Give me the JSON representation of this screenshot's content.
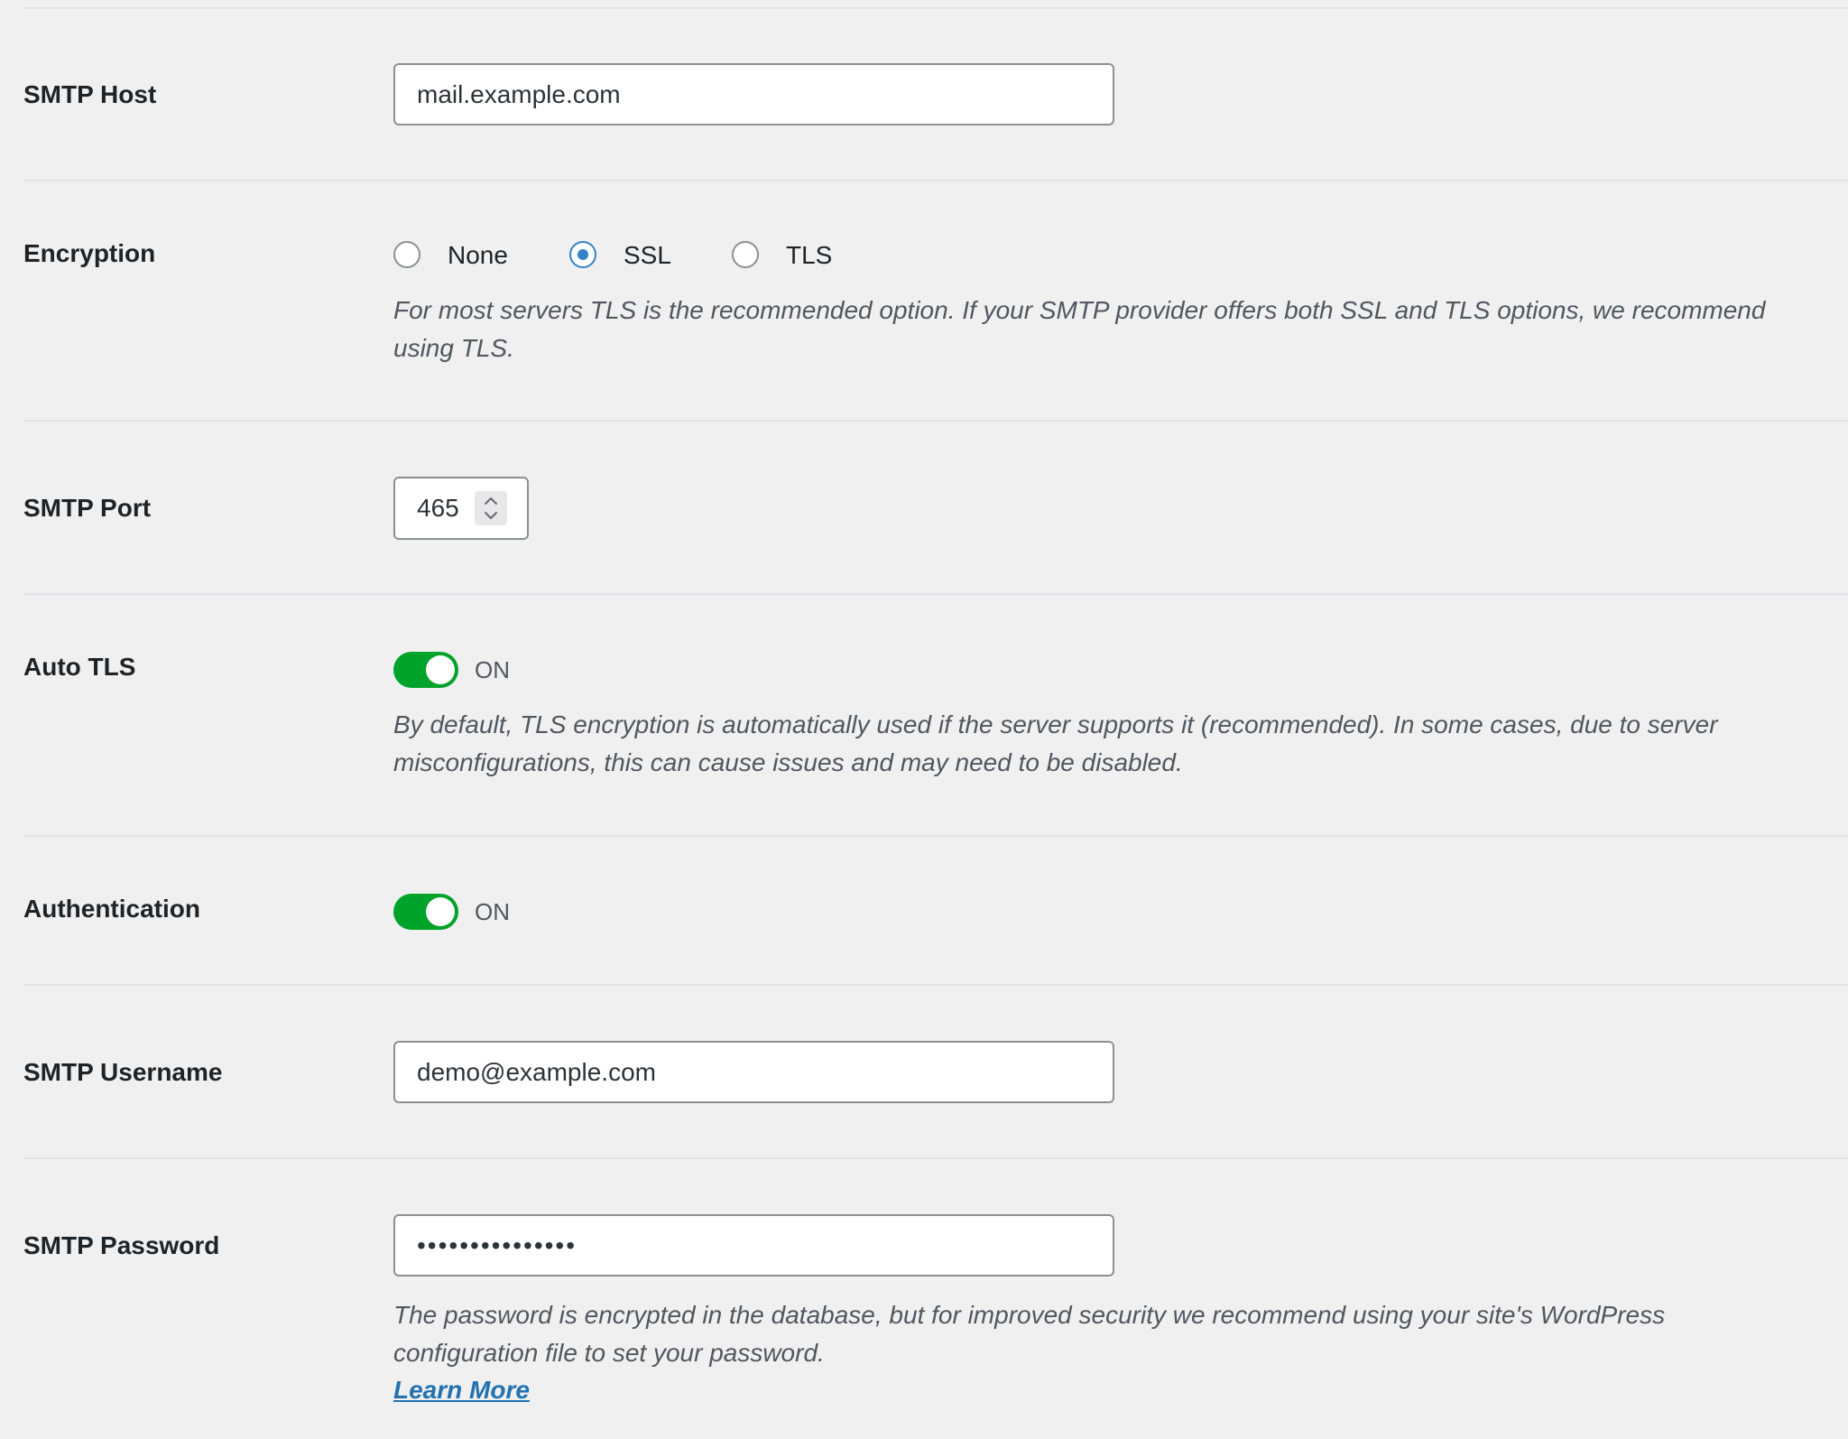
{
  "smtp_host": {
    "label": "SMTP Host",
    "value": "mail.example.com"
  },
  "encryption": {
    "label": "Encryption",
    "options": [
      {
        "label": "None",
        "checked": false
      },
      {
        "label": "SSL",
        "checked": true
      },
      {
        "label": "TLS",
        "checked": false
      }
    ],
    "help_lines": [
      "For most servers TLS is the recommended option. If your SMTP provider offers both SSL and TLS options, we recommend",
      "using TLS."
    ]
  },
  "smtp_port": {
    "label": "SMTP Port",
    "value": "465"
  },
  "auto_tls": {
    "label": "Auto TLS",
    "state": "ON",
    "enabled": true,
    "help_lines": [
      "By default, TLS encryption is automatically used if the server supports it (recommended). In some cases, due to server",
      "misconfigurations, this can cause issues and may need to be disabled."
    ]
  },
  "authentication": {
    "label": "Authentication",
    "state": "ON",
    "enabled": true
  },
  "smtp_username": {
    "label": "SMTP Username",
    "value": "demo@example.com"
  },
  "smtp_password": {
    "label": "SMTP Password",
    "masked_value": "•••••••••••••••",
    "help_lines": [
      "The password is encrypted in the database, but for improved security we recommend using your site's WordPress",
      "configuration file to set your password."
    ],
    "learn_more": "Learn More"
  },
  "colors": {
    "background": "#f0f0f1",
    "toggle_on": "#00a32a",
    "radio_checked": "#3582c4",
    "link": "#2271b1",
    "help_text": "#50575e"
  },
  "icons": {
    "port_spinner": "spinner-up-down-icon"
  }
}
